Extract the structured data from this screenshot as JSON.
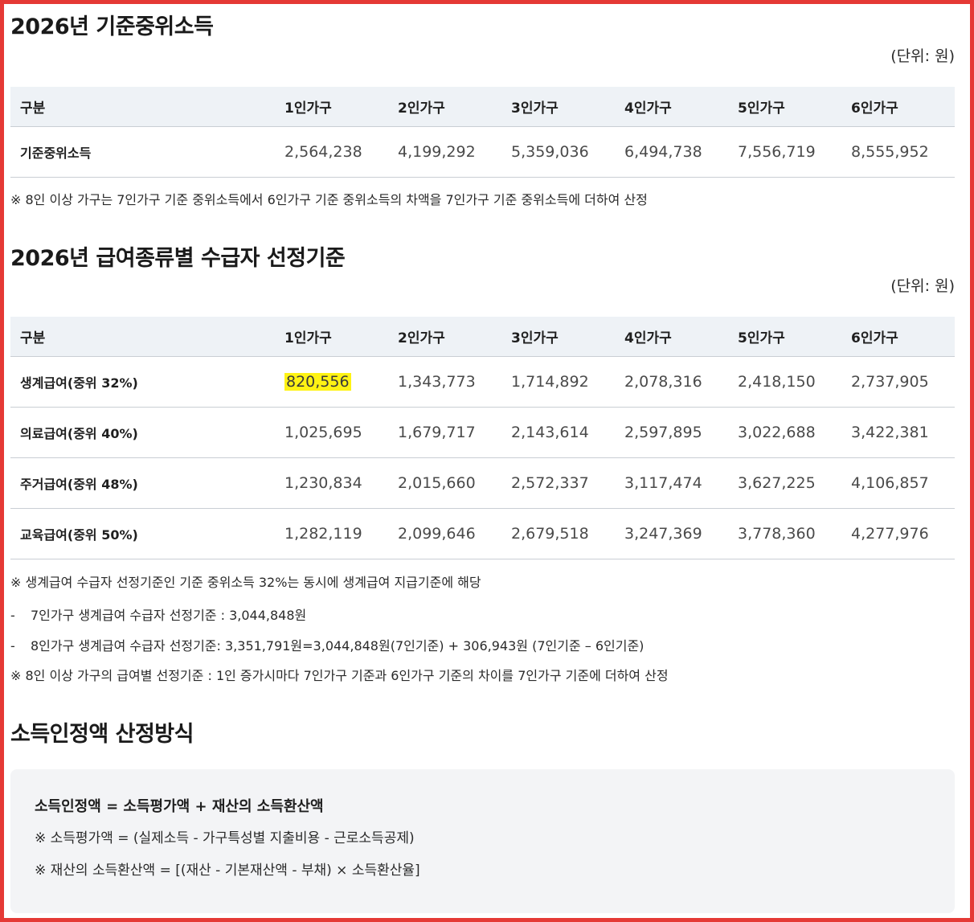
{
  "section1": {
    "title": "2026년 기준중위소득",
    "unit": "(단위: 원)",
    "headers": [
      "구분",
      "1인가구",
      "2인가구",
      "3인가구",
      "4인가구",
      "5인가구",
      "6인가구"
    ],
    "rows": [
      {
        "label": "기준중위소득",
        "values": [
          "2,564,238",
          "4,199,292",
          "5,359,036",
          "6,494,738",
          "7,556,719",
          "8,555,952"
        ]
      }
    ],
    "note": "※ 8인 이상 가구는 7인가구 기준 중위소득에서 6인가구 기준 중위소득의 차액을 7인가구 기준 중위소득에 더하여 산정"
  },
  "section2": {
    "title": "2026년 급여종류별 수급자 선정기준",
    "unit": "(단위: 원)",
    "headers": [
      "구분",
      "1인가구",
      "2인가구",
      "3인가구",
      "4인가구",
      "5인가구",
      "6인가구"
    ],
    "rows": [
      {
        "label": "생계급여(중위 32%)",
        "values": [
          "820,556",
          "1,343,773",
          "1,714,892",
          "2,078,316",
          "2,418,150",
          "2,737,905"
        ]
      },
      {
        "label": "의료급여(중위 40%)",
        "values": [
          "1,025,695",
          "1,679,717",
          "2,143,614",
          "2,597,895",
          "3,022,688",
          "3,422,381"
        ]
      },
      {
        "label": "주거급여(중위 48%)",
        "values": [
          "1,230,834",
          "2,015,660",
          "2,572,337",
          "3,117,474",
          "3,627,225",
          "4,106,857"
        ]
      },
      {
        "label": "교육급여(중위 50%)",
        "values": [
          "1,282,119",
          "2,099,646",
          "2,679,518",
          "3,247,369",
          "3,778,360",
          "4,277,976"
        ]
      }
    ],
    "highlight_color": "#fff314",
    "notes": {
      "n1": "※ 생계급여 수급자 선정기준인 기준 중위소득 32%는 동시에 생계급여 지급기준에 해당",
      "d1_mark": "-",
      "d1": "7인가구 생계급여 수급자 선정기준 : 3,044,848원",
      "d2_mark": "-",
      "d2": "8인가구 생계급여 수급자 선정기준: 3,351,791원=3,044,848원(7인기준) + 306,943원 (7인기준 – 6인기준)",
      "n2": "※ 8인 이상 가구의 급여별 선정기준 : 1인 증가시마다 7인가구 기준과 6인가구 기준의 차이를 7인가구 기준에 더하여 산정"
    }
  },
  "section3": {
    "title": "소득인정액 산정방식",
    "formula": "소득인정액 = 소득평가액 + 재산의 소득환산액",
    "sub1": "※ 소득평가액 = (실제소득 - 가구특성별 지출비용 - 근로소득공제)",
    "sub2": "※ 재산의 소득환산액 = [(재산 - 기본재산액 - 부채) × 소득환산율]"
  },
  "colors": {
    "frame_border": "#e53935",
    "table_header_bg": "#eef2f6",
    "calc_box_bg": "#f3f4f6"
  }
}
